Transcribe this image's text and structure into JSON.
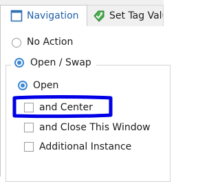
{
  "tabs": [
    {
      "label": "Navigation",
      "icon": "document-icon",
      "active": true
    },
    {
      "label": "Set Tag Valu",
      "icon": "tag-icon",
      "active": false
    }
  ],
  "options": {
    "no_action": "No Action",
    "open_swap": "Open / Swap",
    "open": "Open",
    "and_center": "and Center",
    "and_close": "and Close This Window",
    "additional_instance": "Additional Instance"
  },
  "colors": {
    "active_tab_text": "#1f5fa8",
    "radio_selected": "#3a87d4",
    "annotation": "#0000e6"
  }
}
